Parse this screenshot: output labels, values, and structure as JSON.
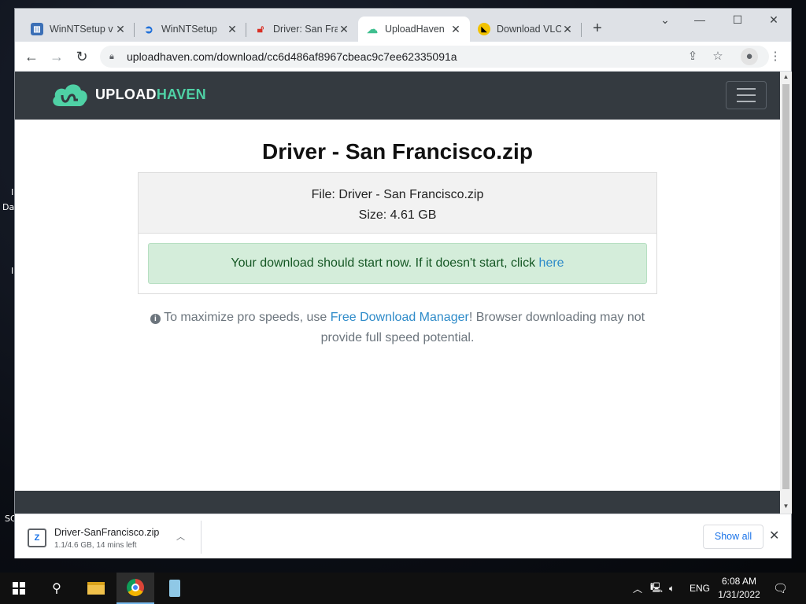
{
  "desktop": {
    "labels": [
      "I",
      "Da",
      "I",
      "SC"
    ]
  },
  "browser": {
    "tabs": [
      {
        "title": "WinNTSetup v",
        "icon": "winntsetup-blue-icon",
        "active": false
      },
      {
        "title": "WinNTSetup",
        "icon": "blue-swirl-icon",
        "active": false
      },
      {
        "title": "Driver: San Fra",
        "icon": "red-lock-icon",
        "active": false
      },
      {
        "title": "UploadHaven",
        "icon": "uploadhaven-icon",
        "active": true
      },
      {
        "title": "Download VLC",
        "icon": "vlc-pacman-icon",
        "active": false
      }
    ],
    "new_tab": "+",
    "url": "uploadhaven.com/download/cc6d486af8967cbeac9c7ee62335091a"
  },
  "site": {
    "logo_text_a": "UPLOAD",
    "logo_text_b": "HAVEN",
    "title": "Driver - San Francisco.zip",
    "file_line": "File: Driver - San Francisco.zip",
    "size_line": "Size: 4.61 GB",
    "alert_text": "Your download should start now. If it doesn't start, click ",
    "alert_link": "here",
    "note_prefix": " To maximize pro speeds, use ",
    "note_link": "Free Download Manager",
    "note_suffix": "! Browser downloading may not provide full speed potential."
  },
  "download_shelf": {
    "filename": "Driver-SanFrancisco.zip",
    "status": "1.1/4.6 GB, 14 mins left",
    "show_all": "Show all"
  },
  "taskbar": {
    "lang": "ENG",
    "time": "6:08 AM",
    "date": "1/31/2022"
  },
  "colors": {
    "nav_dark": "#343a40",
    "alert_bg": "#d4edda",
    "link_blue": "#2e8bc9",
    "brand_green": "#4fd1a5"
  }
}
